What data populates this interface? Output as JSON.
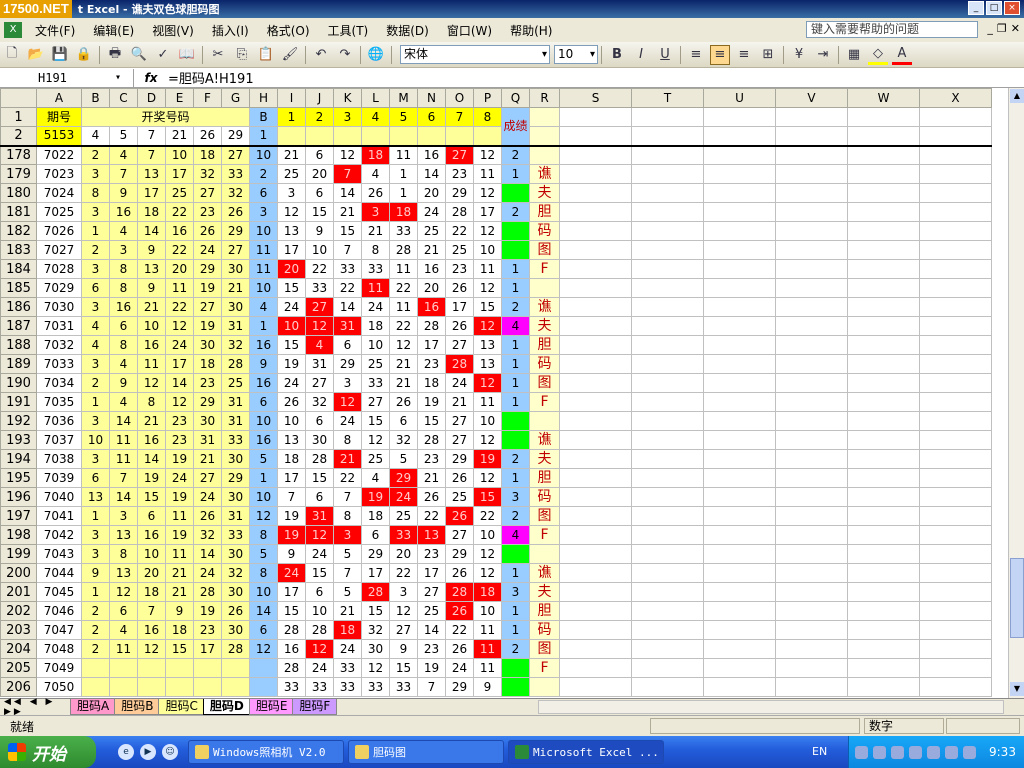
{
  "window": {
    "logo": "17500.NET",
    "title": "t Excel - 谯夫双色球胆码图"
  },
  "menu": {
    "items": [
      "文件(F)",
      "编辑(E)",
      "视图(V)",
      "插入(I)",
      "格式(O)",
      "工具(T)",
      "数据(D)",
      "窗口(W)",
      "帮助(H)"
    ],
    "help_placeholder": "键入需要帮助的问题"
  },
  "toolbar": {
    "font": "宋体",
    "size": "10",
    "bold": "B",
    "italic": "I",
    "underline": "U"
  },
  "formula_bar": {
    "cell_ref": "H191",
    "fx": "fx",
    "formula": "=胆码A!H191"
  },
  "colors": {
    "yellow": "#ffff99",
    "blue": "#99ccff",
    "red": "#ff0000",
    "green": "#00ff00",
    "magenta": "#ff00ff",
    "header_yellow": "#ffff00"
  },
  "columns": [
    "A",
    "B",
    "C",
    "D",
    "E",
    "F",
    "G",
    "H",
    "I",
    "J",
    "K",
    "L",
    "M",
    "N",
    "O",
    "P",
    "Q",
    "R",
    "S",
    "T",
    "U",
    "V",
    "W",
    "X"
  ],
  "header_rows": [
    {
      "row": "1",
      "period_label": "期号",
      "draw_label": "开奖号码",
      "h": "B",
      "nums": [
        "1",
        "2",
        "3",
        "4",
        "5",
        "6",
        "7",
        "8"
      ],
      "score_label": "成绩"
    },
    {
      "row": "2",
      "period": "5153",
      "draw": [
        "4",
        "5",
        "7",
        "21",
        "26",
        "29"
      ],
      "h": "1"
    }
  ],
  "rows": [
    {
      "r": "178",
      "a": "7022",
      "draw": [
        "2",
        "4",
        "7",
        "10",
        "18",
        "27"
      ],
      "h": "10",
      "ip": [
        "21",
        "6",
        "12",
        "18",
        "11",
        "16",
        "27",
        "12"
      ],
      "red": [
        3,
        6
      ],
      "q": "2",
      "qc": "",
      "rt": ""
    },
    {
      "r": "179",
      "a": "7023",
      "draw": [
        "3",
        "7",
        "13",
        "17",
        "32",
        "33"
      ],
      "h": "2",
      "ip": [
        "25",
        "20",
        "7",
        "4",
        "1",
        "14",
        "23",
        "11"
      ],
      "red": [
        2
      ],
      "q": "1",
      "qc": "",
      "rt": "谯"
    },
    {
      "r": "180",
      "a": "7024",
      "draw": [
        "8",
        "9",
        "17",
        "25",
        "27",
        "32"
      ],
      "h": "6",
      "ip": [
        "3",
        "6",
        "14",
        "26",
        "1",
        "20",
        "29",
        "12"
      ],
      "red": [],
      "q": "",
      "qc": "green",
      "rt": "夫"
    },
    {
      "r": "181",
      "a": "7025",
      "draw": [
        "3",
        "16",
        "18",
        "22",
        "23",
        "26"
      ],
      "h": "3",
      "ip": [
        "12",
        "15",
        "21",
        "3",
        "18",
        "24",
        "28",
        "17"
      ],
      "red": [
        3,
        4
      ],
      "q": "2",
      "qc": "",
      "rt": "胆"
    },
    {
      "r": "182",
      "a": "7026",
      "draw": [
        "1",
        "4",
        "14",
        "16",
        "26",
        "29"
      ],
      "h": "10",
      "ip": [
        "13",
        "9",
        "15",
        "21",
        "33",
        "25",
        "22",
        "12"
      ],
      "red": [],
      "q": "",
      "qc": "green",
      "rt": "码"
    },
    {
      "r": "183",
      "a": "7027",
      "draw": [
        "2",
        "3",
        "9",
        "22",
        "24",
        "27"
      ],
      "h": "11",
      "ip": [
        "17",
        "10",
        "7",
        "8",
        "28",
        "21",
        "25",
        "10"
      ],
      "red": [],
      "q": "",
      "qc": "green",
      "rt": "图"
    },
    {
      "r": "184",
      "a": "7028",
      "draw": [
        "3",
        "8",
        "13",
        "20",
        "29",
        "30"
      ],
      "h": "11",
      "ip": [
        "20",
        "22",
        "33",
        "33",
        "11",
        "16",
        "23",
        "11"
      ],
      "red": [
        0
      ],
      "q": "1",
      "qc": "",
      "rt": "F"
    },
    {
      "r": "185",
      "a": "7029",
      "draw": [
        "6",
        "8",
        "9",
        "11",
        "19",
        "21"
      ],
      "h": "10",
      "ip": [
        "15",
        "33",
        "22",
        "11",
        "22",
        "20",
        "26",
        "12"
      ],
      "red": [
        3
      ],
      "q": "1",
      "qc": "",
      "rt": ""
    },
    {
      "r": "186",
      "a": "7030",
      "draw": [
        "3",
        "16",
        "21",
        "22",
        "27",
        "30"
      ],
      "h": "4",
      "ip": [
        "24",
        "27",
        "14",
        "24",
        "11",
        "16",
        "17",
        "15"
      ],
      "red": [
        1,
        5
      ],
      "q": "2",
      "qc": "",
      "rt": "谯"
    },
    {
      "r": "187",
      "a": "7031",
      "draw": [
        "4",
        "6",
        "10",
        "12",
        "19",
        "31"
      ],
      "h": "1",
      "ip": [
        "10",
        "12",
        "31",
        "18",
        "22",
        "28",
        "26",
        "12"
      ],
      "red": [
        0,
        1,
        2,
        7
      ],
      "q": "4",
      "qc": "magenta",
      "rt": "夫"
    },
    {
      "r": "188",
      "a": "7032",
      "draw": [
        "4",
        "8",
        "16",
        "24",
        "30",
        "32"
      ],
      "h": "16",
      "ip": [
        "15",
        "4",
        "6",
        "10",
        "12",
        "17",
        "27",
        "13"
      ],
      "red": [
        1
      ],
      "q": "1",
      "qc": "",
      "rt": "胆"
    },
    {
      "r": "189",
      "a": "7033",
      "draw": [
        "3",
        "4",
        "11",
        "17",
        "18",
        "28"
      ],
      "h": "9",
      "ip": [
        "19",
        "31",
        "29",
        "25",
        "21",
        "23",
        "28",
        "13"
      ],
      "red": [
        6
      ],
      "q": "1",
      "qc": "",
      "rt": "码"
    },
    {
      "r": "190",
      "a": "7034",
      "draw": [
        "2",
        "9",
        "12",
        "14",
        "23",
        "25"
      ],
      "h": "16",
      "ip": [
        "24",
        "27",
        "3",
        "33",
        "21",
        "18",
        "24",
        "12"
      ],
      "red": [
        7
      ],
      "q": "1",
      "qc": "",
      "rt": "图"
    },
    {
      "r": "191",
      "a": "7035",
      "draw": [
        "1",
        "4",
        "8",
        "12",
        "29",
        "31"
      ],
      "h": "6",
      "ip": [
        "26",
        "32",
        "12",
        "27",
        "26",
        "19",
        "21",
        "11"
      ],
      "red": [
        2
      ],
      "q": "1",
      "qc": "",
      "rt": "F"
    },
    {
      "r": "192",
      "a": "7036",
      "draw": [
        "3",
        "14",
        "21",
        "23",
        "30",
        "31"
      ],
      "h": "10",
      "ip": [
        "10",
        "6",
        "24",
        "15",
        "6",
        "15",
        "27",
        "10"
      ],
      "red": [],
      "q": "",
      "qc": "green",
      "rt": ""
    },
    {
      "r": "193",
      "a": "7037",
      "draw": [
        "10",
        "11",
        "16",
        "23",
        "31",
        "33"
      ],
      "h": "16",
      "ip": [
        "13",
        "30",
        "8",
        "12",
        "32",
        "28",
        "27",
        "12"
      ],
      "red": [],
      "q": "",
      "qc": "green",
      "rt": "谯"
    },
    {
      "r": "194",
      "a": "7038",
      "draw": [
        "3",
        "11",
        "14",
        "19",
        "21",
        "30"
      ],
      "h": "5",
      "ip": [
        "18",
        "28",
        "21",
        "25",
        "5",
        "23",
        "29",
        "19"
      ],
      "red": [
        2,
        7
      ],
      "q": "2",
      "qc": "",
      "rt": "夫"
    },
    {
      "r": "195",
      "a": "7039",
      "draw": [
        "6",
        "7",
        "19",
        "24",
        "27",
        "29"
      ],
      "h": "1",
      "ip": [
        "17",
        "15",
        "22",
        "4",
        "29",
        "21",
        "26",
        "12"
      ],
      "red": [
        4
      ],
      "q": "1",
      "qc": "",
      "rt": "胆"
    },
    {
      "r": "196",
      "a": "7040",
      "draw": [
        "13",
        "14",
        "15",
        "19",
        "24",
        "30"
      ],
      "h": "10",
      "ip": [
        "7",
        "6",
        "7",
        "19",
        "24",
        "26",
        "25",
        "15"
      ],
      "red": [
        3,
        4,
        7
      ],
      "q": "3",
      "qc": "",
      "rt": "码"
    },
    {
      "r": "197",
      "a": "7041",
      "draw": [
        "1",
        "3",
        "6",
        "11",
        "26",
        "31"
      ],
      "h": "12",
      "ip": [
        "19",
        "31",
        "8",
        "18",
        "25",
        "22",
        "26",
        "22"
      ],
      "red": [
        1,
        6
      ],
      "q": "2",
      "qc": "",
      "rt": "图"
    },
    {
      "r": "198",
      "a": "7042",
      "draw": [
        "3",
        "13",
        "16",
        "19",
        "32",
        "33"
      ],
      "h": "8",
      "ip": [
        "19",
        "12",
        "3",
        "6",
        "33",
        "13",
        "27",
        "10"
      ],
      "red": [
        0,
        1,
        2,
        4,
        5
      ],
      "q": "4",
      "qc": "magenta",
      "rt": "F"
    },
    {
      "r": "199",
      "a": "7043",
      "draw": [
        "3",
        "8",
        "10",
        "11",
        "14",
        "30"
      ],
      "h": "5",
      "ip": [
        "9",
        "24",
        "5",
        "29",
        "20",
        "23",
        "29",
        "12"
      ],
      "red": [],
      "q": "",
      "qc": "green",
      "rt": ""
    },
    {
      "r": "200",
      "a": "7044",
      "draw": [
        "9",
        "13",
        "20",
        "21",
        "24",
        "32"
      ],
      "h": "8",
      "ip": [
        "24",
        "15",
        "7",
        "17",
        "22",
        "17",
        "26",
        "12"
      ],
      "red": [
        0
      ],
      "q": "1",
      "qc": "",
      "rt": "谯"
    },
    {
      "r": "201",
      "a": "7045",
      "draw": [
        "1",
        "12",
        "18",
        "21",
        "28",
        "30"
      ],
      "h": "10",
      "ip": [
        "17",
        "6",
        "5",
        "28",
        "3",
        "27",
        "28",
        "18"
      ],
      "red": [
        3,
        6,
        7
      ],
      "q": "3",
      "qc": "",
      "rt": "夫"
    },
    {
      "r": "202",
      "a": "7046",
      "draw": [
        "2",
        "6",
        "7",
        "9",
        "19",
        "26"
      ],
      "h": "14",
      "ip": [
        "15",
        "10",
        "21",
        "15",
        "12",
        "25",
        "26",
        "10"
      ],
      "red": [
        6
      ],
      "q": "1",
      "qc": "",
      "rt": "胆"
    },
    {
      "r": "203",
      "a": "7047",
      "draw": [
        "2",
        "4",
        "16",
        "18",
        "23",
        "30"
      ],
      "h": "6",
      "ip": [
        "28",
        "28",
        "18",
        "32",
        "27",
        "14",
        "22",
        "11"
      ],
      "red": [
        2
      ],
      "q": "1",
      "qc": "",
      "rt": "码"
    },
    {
      "r": "204",
      "a": "7048",
      "draw": [
        "2",
        "11",
        "12",
        "15",
        "17",
        "28"
      ],
      "h": "12",
      "ip": [
        "16",
        "12",
        "24",
        "30",
        "9",
        "23",
        "26",
        "11"
      ],
      "red": [
        1,
        7
      ],
      "q": "2",
      "qc": "",
      "rt": "图"
    },
    {
      "r": "205",
      "a": "7049",
      "draw": [
        "",
        "",
        "",
        "",
        "",
        ""
      ],
      "h": "",
      "ip": [
        "28",
        "24",
        "33",
        "12",
        "15",
        "19",
        "24",
        "11"
      ],
      "red": [],
      "q": "",
      "qc": "green",
      "rt": "F"
    },
    {
      "r": "206",
      "a": "7050",
      "draw": [
        "",
        "",
        "",
        "",
        "",
        ""
      ],
      "h": "",
      "ip": [
        "33",
        "33",
        "33",
        "33",
        "33",
        "7",
        "29",
        "9"
      ],
      "red": [],
      "q": "",
      "qc": "green",
      "rt": ""
    }
  ],
  "sheet_tabs": [
    "胆码A",
    "胆码B",
    "胆码C",
    "胆码D",
    "胆码E",
    "胆码F"
  ],
  "tab_colors": [
    "#ff99cc",
    "#ffcc99",
    "#ffff99",
    "#ffffff",
    "#ff99ff",
    "#cc99ff"
  ],
  "status": {
    "ready": "就绪",
    "mode": "数字"
  },
  "taskbar": {
    "start": "开始",
    "tasks": [
      "Windows照相机 V2.0",
      "胆码图",
      "Microsoft Excel ..."
    ],
    "lang": "EN",
    "time": "9:33"
  }
}
